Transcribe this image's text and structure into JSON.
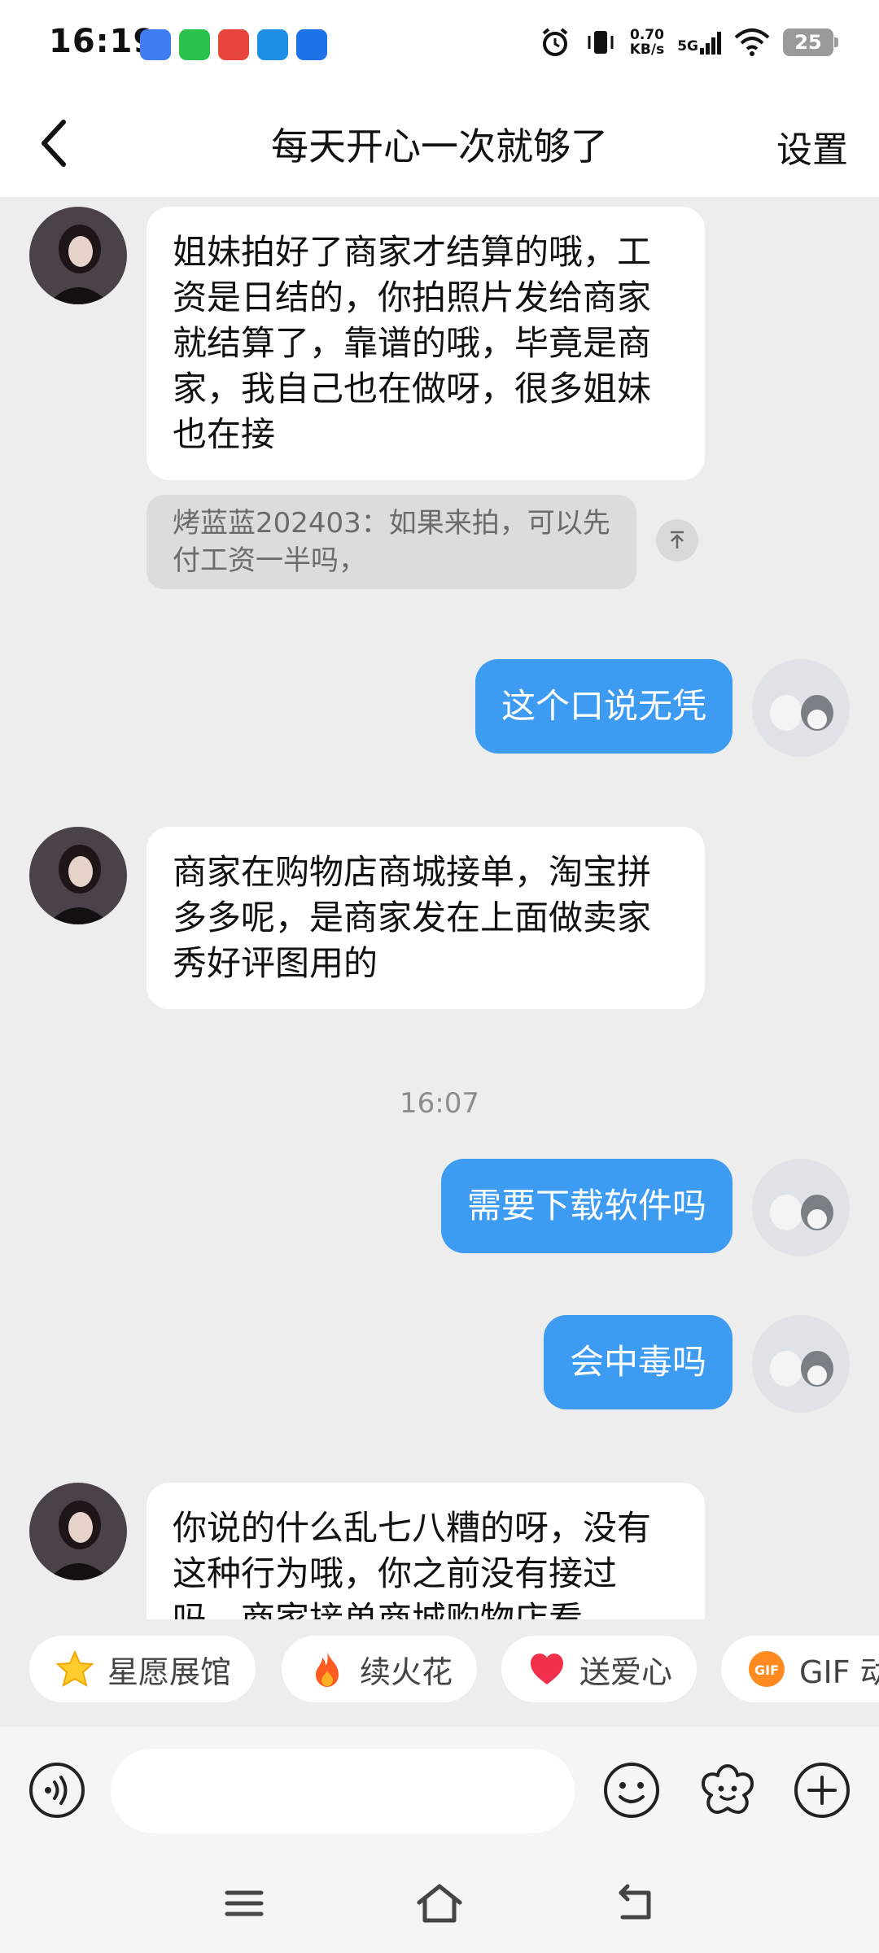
{
  "status_bar": {
    "time": "16:19",
    "network_speed_value": "0.70",
    "network_speed_unit": "KB/s",
    "signal_type": "5G",
    "battery": "25"
  },
  "header": {
    "title": "每天开心一次就够了",
    "settings_label": "设置"
  },
  "messages": [
    {
      "side": "in",
      "text": "姐妹拍好了商家才结算的哦，工资是日结的，你拍照片发给商家就结算了，靠谱的哦，毕竟是商家，我自己也在做呀，很多姐妹也在接"
    },
    {
      "side": "quote",
      "text": "烤蓝蓝202403：如果来拍，可以先付工资一半吗，"
    },
    {
      "side": "out",
      "text": "这个口说无凭"
    },
    {
      "side": "in",
      "text": "商家在购物店商城接单，淘宝拼多多呢，是商家发在上面做卖家秀好评图用的"
    },
    {
      "side": "time",
      "text": "16:07"
    },
    {
      "side": "out",
      "text": "需要下载软件吗"
    },
    {
      "side": "out",
      "text": "会中毒吗"
    },
    {
      "side": "in",
      "text": "你说的什么乱七八糟的呀，没有这种行为哦，你之前没有接过吗，商家接单商城购物店看"
    }
  ],
  "quick_actions": [
    {
      "label": "星愿展馆",
      "icon": "star-icon"
    },
    {
      "label": "续火花",
      "icon": "fire-icon"
    },
    {
      "label": "送爱心",
      "icon": "heart-icon"
    },
    {
      "label": "GIF 动",
      "icon": "gif-icon"
    }
  ],
  "input": {
    "placeholder": ""
  },
  "colors": {
    "outgoing_bubble": "#3d9bf2",
    "incoming_bubble": "#ffffff",
    "chat_background": "#ededed"
  }
}
